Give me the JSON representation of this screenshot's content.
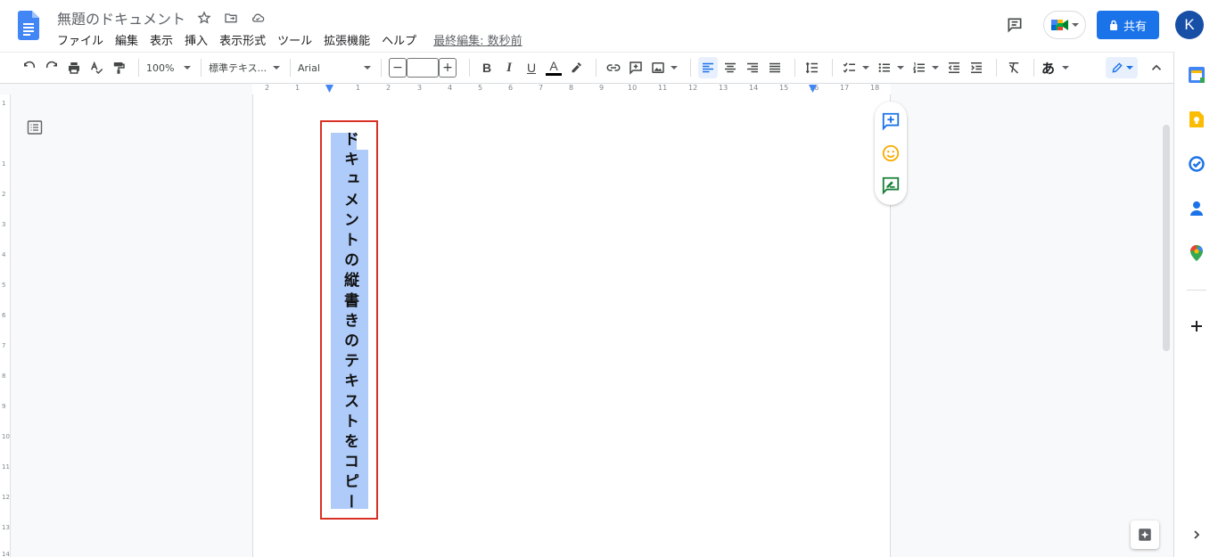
{
  "header": {
    "doc_title": "無題のドキュメント",
    "menu": [
      "ファイル",
      "編集",
      "表示",
      "挿入",
      "表示形式",
      "ツール",
      "拡張機能",
      "ヘルプ"
    ],
    "last_edit": "最終編集: 数秒前",
    "share_label": "共有",
    "avatar_letter": "K"
  },
  "toolbar": {
    "zoom": "100%",
    "style": "標準テキス...",
    "font": "Arial",
    "font_size": "",
    "minus": "−",
    "plus": "+",
    "bold": "B",
    "italic": "I",
    "underline": "U",
    "text_color": "A",
    "input_tools": "あ"
  },
  "ruler": {
    "h_ticks": [
      "2",
      "1",
      "1",
      "2",
      "3",
      "4",
      "5",
      "6",
      "7",
      "8",
      "9",
      "10",
      "11",
      "12",
      "13",
      "14",
      "15",
      "16",
      "17",
      "18"
    ],
    "v_ticks": [
      "1",
      "1",
      "2",
      "3",
      "4",
      "5",
      "6",
      "7",
      "8",
      "9",
      "10",
      "11",
      "12",
      "13",
      "14"
    ]
  },
  "document": {
    "vertical_text": "ドキュメントの縦書きのテキストをコピー"
  },
  "colors": {
    "accent": "#1a73e8",
    "highlight": "#aecbfa",
    "selection_border": "#d93025"
  }
}
